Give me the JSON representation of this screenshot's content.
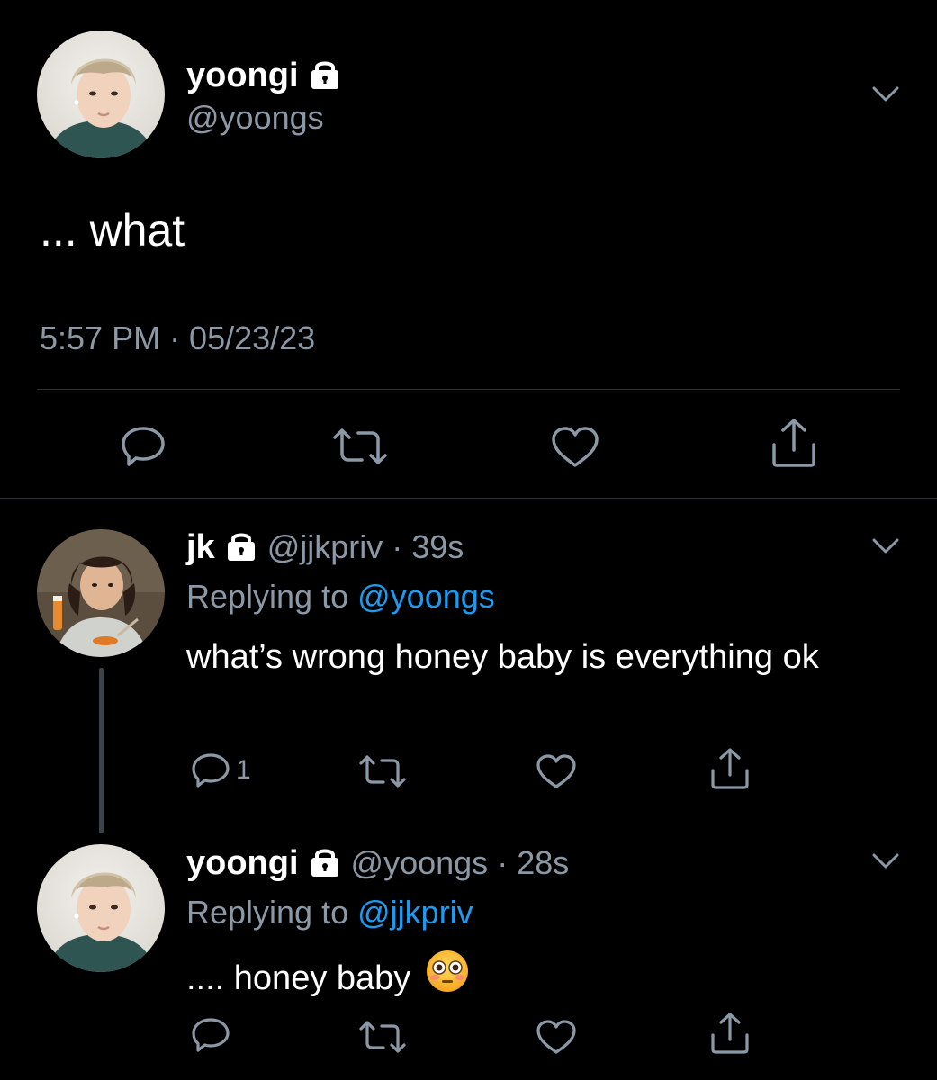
{
  "main_tweet": {
    "author": "yoongi",
    "handle": "@yoongs",
    "text": "... what",
    "timestamp": "5:57 PM · 05/23/23"
  },
  "replies": [
    {
      "author": "jk",
      "handle": "@jjkpriv",
      "time": "39s",
      "replying_prefix": "Replying to",
      "replying_to": "@yoongs",
      "text": "what’s wrong honey baby is everything ok",
      "reply_count": "1"
    },
    {
      "author": "yoongi",
      "handle": "@yoongs",
      "time": "28s",
      "replying_prefix": "Replying to",
      "replying_to": "@jjkpriv",
      "text": ".... honey baby",
      "emoji": "flushed-face-icon"
    }
  ],
  "colors": {
    "background": "#000000",
    "primary_text": "#ffffff",
    "secondary_text": "#8b98a5",
    "link": "#1d9bf0",
    "divider": "#2f3336"
  },
  "icons": [
    "lock-icon",
    "chevron-down-icon",
    "reply-icon",
    "retweet-icon",
    "like-icon",
    "share-icon"
  ]
}
